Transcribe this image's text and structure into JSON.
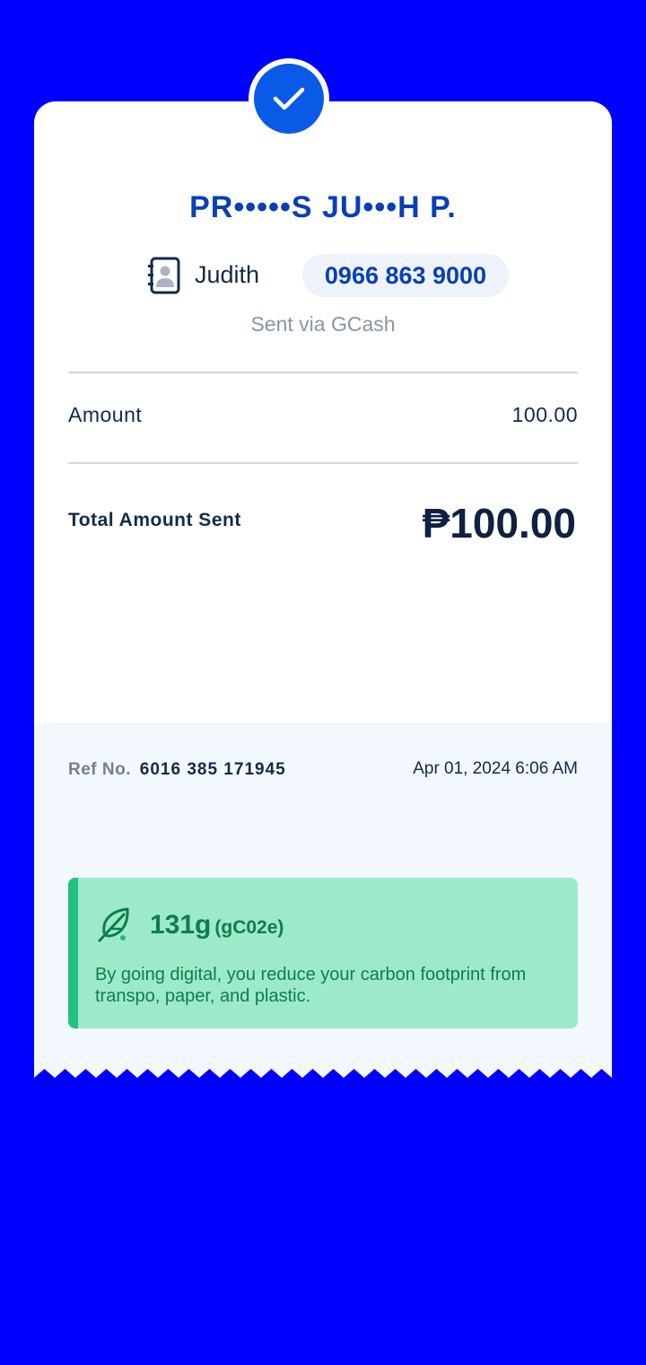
{
  "recipient": {
    "masked_name": "PR•••••S JU•••H P.",
    "contact_name": "Judith",
    "phone": "0966 863 9000",
    "sent_via": "Sent via GCash"
  },
  "details": {
    "amount_label": "Amount",
    "amount_value": "100.00",
    "total_label": "Total Amount Sent",
    "total_value": "₱100.00"
  },
  "reference": {
    "label": "Ref No.",
    "number": "6016 385 171945",
    "datetime": "Apr 01, 2024 6:06 AM"
  },
  "eco": {
    "amount": "131g",
    "unit": "(gC02e)",
    "message": "By going digital, you reduce your carbon footprint from transpo, paper, and plastic."
  },
  "icons": {
    "status": "check-icon",
    "contact": "contact-book-icon",
    "eco": "leaf-icon"
  },
  "colors": {
    "background": "#0000FF",
    "brand_blue": "#0A5AE8",
    "eco_green_bg": "#9CEACB",
    "eco_green_text": "#0E7E4A"
  }
}
